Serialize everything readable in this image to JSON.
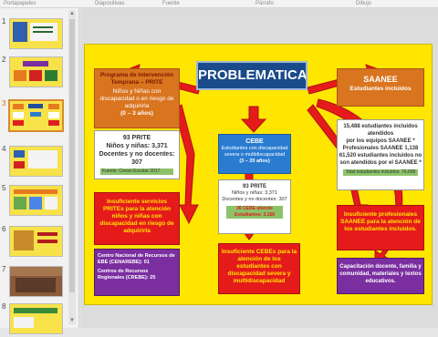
{
  "ribbon": {
    "labels": [
      "Portapapeles",
      "Diapositivas",
      "Fuente",
      "Párrafo",
      "Dibujo"
    ]
  },
  "thumbnails": [
    {
      "number": "1"
    },
    {
      "number": "2"
    },
    {
      "number": "3"
    },
    {
      "number": "4"
    },
    {
      "number": "5"
    },
    {
      "number": "6"
    },
    {
      "number": "7"
    },
    {
      "number": "8"
    }
  ],
  "slide": {
    "title": "PROBLEMATICA",
    "prite": {
      "heading": "Programa de Intervención Temprana – PRITE",
      "body": "Niños y Niñas con discapacidad o en riesgo de adquirirla",
      "ages": "(0 – 3 años)"
    },
    "prite_stats": {
      "count": "93 PRITE",
      "children": "Niños y niñas: 3,371",
      "teachers": "Docentes y no docentes: 307",
      "source": "Fuente: Censo Escolar 2017"
    },
    "prite_problem": "Insuficiente servicios PRITEs para la atención niños y niñas con discapacidad en riesgo de adquirirla",
    "centers": {
      "national": "Centro Nacional de Recursos de EBE (CENAREBE): 01",
      "regional": "Centros de Recursos Regionales (CREBE): 25"
    },
    "cebe": {
      "heading": "CEBE",
      "body": "Estudiantes con discapacidad severa o multidiscapacidad",
      "ages": "(3 – 20 años)"
    },
    "cebe_stats": {
      "count": "93 PRITE",
      "children": "Niños y niñas: 3,371",
      "teachers": "Docentes y no docentes: 307",
      "note": "36 CEBE atiende Estudiantes: 3,168"
    },
    "cebe_problem": "Insuficiente CEBEs para la atención de los estudiantes con discapacidad severa y multidiscapacidad",
    "saanee": {
      "heading": "SAANEE",
      "subheading": "Estudiantes incluidos"
    },
    "saanee_stats": {
      "students": "15,488 estudiantes incluidos atendidos",
      "by_saanee": "por los equipos SAANEE *",
      "professionals": "Profesionales SAANEE 1,138",
      "not_served": "61,520 estudiantes incluidos no son atendidos por el SAANEE *",
      "total": "Total estudiantes incluidos: 76,008"
    },
    "saanee_problem": "Insuficiente profesionales SAANEE para la atención de los estudiantes incluidos.",
    "training": "Capacitación docente, familia y comunidad, materiales y textos educativos."
  }
}
